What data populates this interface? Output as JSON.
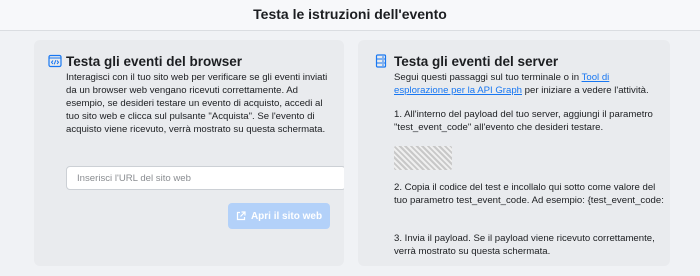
{
  "header": {
    "title": "Testa le istruzioni dell'evento"
  },
  "browser_card": {
    "title": "Testa gli eventi del browser",
    "icon": "code-window-icon",
    "description": "Interagisci con il tuo sito web per verificare se gli eventi inviati da un browser web vengano ricevuti correttamente. Ad esempio, se desideri testare un evento di acquisto, accedi al tuo sito web e clicca sul pulsante \"Acquista\". Se l'evento di acquisto viene ricevuto, verrà mostrato su questa schermata.",
    "url_placeholder": "Inserisci l'URL del sito web",
    "open_button": "Apri il sito web",
    "open_button_icon": "external-link-icon"
  },
  "server_card": {
    "title": "Testa gli eventi del server",
    "icon": "server-icon",
    "intro_before": "Segui questi passaggi sul tuo terminale o in ",
    "intro_link": "Tool di esplorazione per la API Graph",
    "intro_after": " per iniziare a vedere l'attività.",
    "step1": "1. All'interno del payload del tuo server, aggiungi il parametro \"test_event_code\" all'evento che desideri testare.",
    "step2": "2. Copia il codice del test e incollalo qui sotto come valore del tuo parametro test_event_code. Ad esempio: {test_event_code:",
    "step3": "3. Invia il payload. Se il payload viene ricevuto correttamente, verrà mostrato su questa schermata."
  },
  "colors": {
    "link": "#1877f2",
    "button_disabled": "#b3d1f9",
    "card_bg": "#e9ebee"
  }
}
